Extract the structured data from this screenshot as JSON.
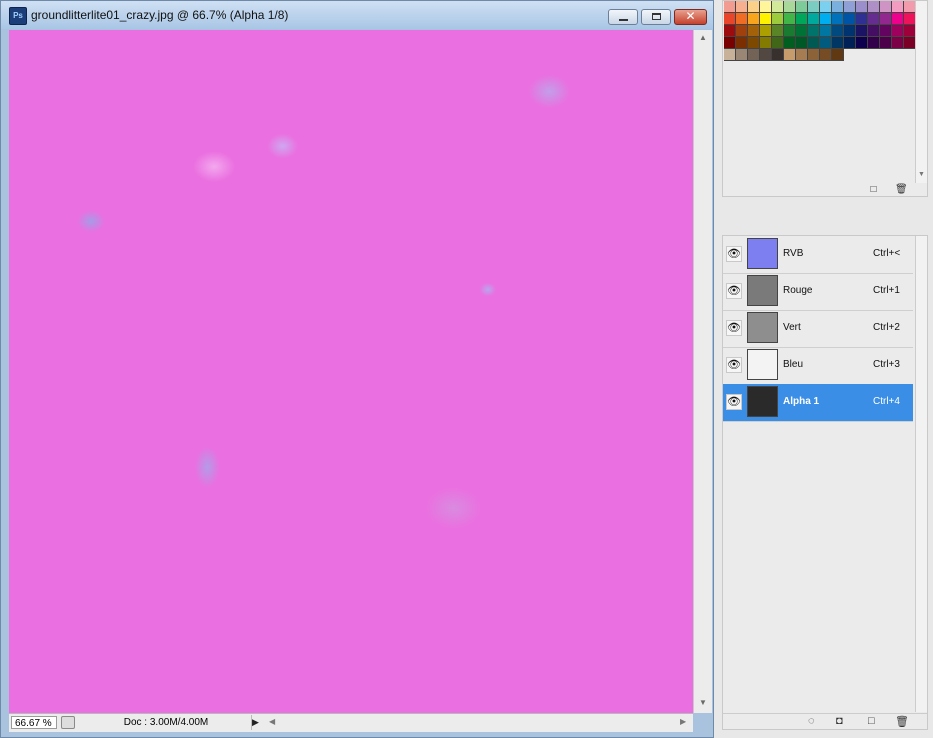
{
  "window": {
    "app_icon_text": "Ps",
    "title": "groundlitterlite01_crazy.jpg @ 66.7% (Alpha 1/8)",
    "controls": {
      "minimize": "minimize-icon",
      "maximize": "maximize-icon",
      "close": "close-icon",
      "close_glyph": "✕"
    }
  },
  "status": {
    "zoom": "66.67 %",
    "doc_info": "Doc : 3.00M/4.00M",
    "menu_arrow": "▶",
    "left_arrow": "◀",
    "right_arrow": "▶",
    "up_arrow": "▲",
    "down_arrow": "▼"
  },
  "swatches": {
    "colors": [
      "#f29b90",
      "#f6b090",
      "#fbd088",
      "#fff59a",
      "#d3e99a",
      "#a8d89a",
      "#7ecb9a",
      "#7ccdc1",
      "#7ad0ee",
      "#7ab0dd",
      "#8ea0d6",
      "#9b8fcb",
      "#ae8fc6",
      "#cf93c4",
      "#f29cc2",
      "#f29bac",
      "#e8452a",
      "#ee6c24",
      "#f7a51c",
      "#fff200",
      "#9ccc3b",
      "#42b549",
      "#00a65a",
      "#00a99d",
      "#00aeef",
      "#0072bc",
      "#0054a6",
      "#2e3192",
      "#662d91",
      "#92278f",
      "#ec008c",
      "#ed145b",
      "#9e0b0f",
      "#a0410d",
      "#a36209",
      "#aba000",
      "#598527",
      "#197b30",
      "#007236",
      "#00746b",
      "#0076a3",
      "#004a80",
      "#003471",
      "#1b1464",
      "#440e62",
      "#630460",
      "#9e005d",
      "#9e0039",
      "#790000",
      "#7b2e00",
      "#7d4900",
      "#827b00",
      "#406618",
      "#005e20",
      "#005826",
      "#005952",
      "#005b7f",
      "#003663",
      "#002157",
      "#0d004c",
      "#32004b",
      "#4b0049",
      "#7b0046",
      "#7a0026",
      "#c7b299",
      "#998675",
      "#736357",
      "#534741",
      "#37302d",
      "#c69c6d",
      "#a67c52",
      "#8c6239",
      "#754c24",
      "#603913"
    ],
    "new_icon": "□",
    "trash_icon": "🗑"
  },
  "channels": {
    "eye_glyph": "👁",
    "rows": [
      {
        "name": "RVB",
        "shortcut": "Ctrl+<",
        "thumb": "#7d7ef0"
      },
      {
        "name": "Rouge",
        "shortcut": "Ctrl+1",
        "thumb": "#7a7a7a"
      },
      {
        "name": "Vert",
        "shortcut": "Ctrl+2",
        "thumb": "#8e8e8e"
      },
      {
        "name": "Bleu",
        "shortcut": "Ctrl+3",
        "thumb": "#f3f3f3"
      },
      {
        "name": "Alpha 1",
        "shortcut": "Ctrl+4",
        "thumb": "#2a2a2a"
      }
    ],
    "footer": {
      "load_selection": "◌",
      "save_selection": "◘",
      "new_channel": "□",
      "delete": "🗑"
    }
  }
}
